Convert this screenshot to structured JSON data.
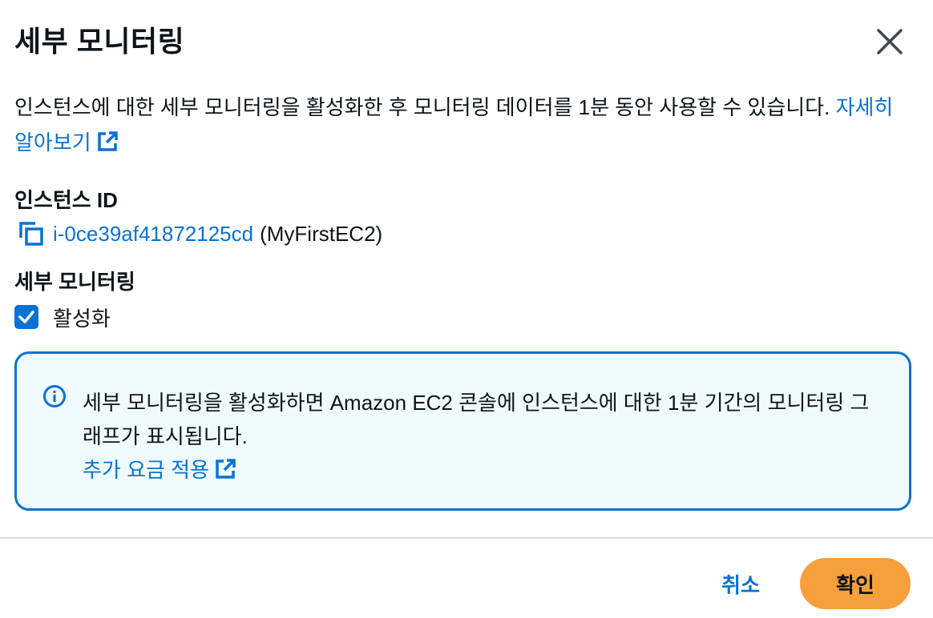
{
  "modal": {
    "title": "세부 모니터링",
    "close_icon": "close-icon"
  },
  "description": {
    "text": "인스턴스에 대한 세부 모니터링을 활성화한 후 모니터링 데이터를 1분 동안 사용할 수 있습니다. ",
    "link_label": "자세히 알아보기",
    "link_icon": "external-link-icon"
  },
  "instance": {
    "label": "인스턴스 ID",
    "copy_icon": "copy-icon",
    "id": "i-0ce39af41872125cd",
    "name": "(MyFirstEC2)"
  },
  "monitoring": {
    "label": "세부 모니터링",
    "checkbox_label": "활성화",
    "checked": true
  },
  "alert": {
    "icon": "info-icon",
    "text": "세부 모니터링을 활성화하면 Amazon EC2 콘솔에 인스턴스에 대한 1분 기간의 모니터링 그래프가 표시됩니다.",
    "link_label": "추가 요금 적용",
    "link_icon": "external-link-icon"
  },
  "footer": {
    "cancel_label": "취소",
    "confirm_label": "확인"
  },
  "colors": {
    "link": "#0972d3",
    "primary_button": "#f5a03c",
    "alert_background": "#f0fbff",
    "divider": "#d5dbdb"
  }
}
